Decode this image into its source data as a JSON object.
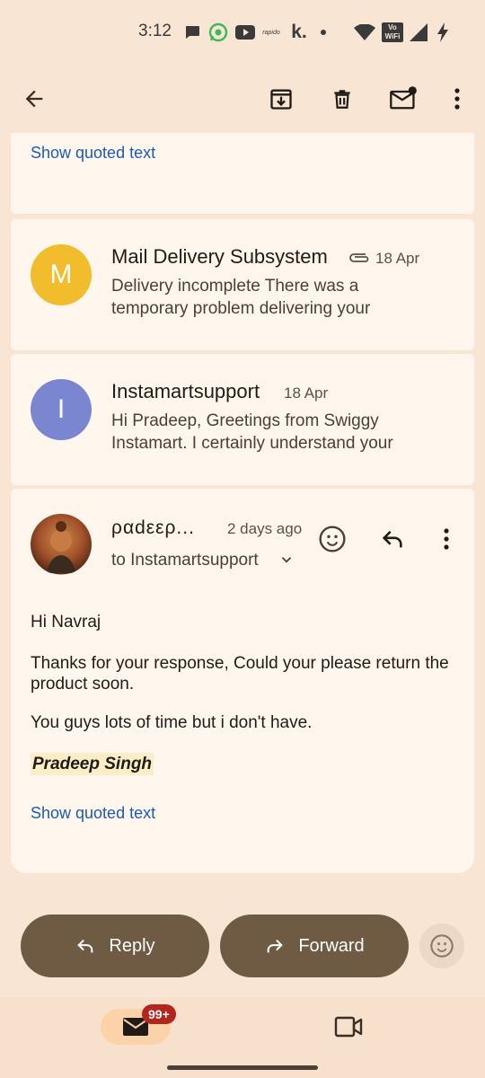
{
  "status_bar": {
    "time": "3:12",
    "rapido_label": "rapido",
    "k_label": "k.",
    "vowifi_label": "Vo WiFi"
  },
  "app_bar": {
    "icons": [
      "back-arrow-icon",
      "archive-icon",
      "delete-icon",
      "mark-unread-icon",
      "more-vert-icon"
    ]
  },
  "thread": {
    "top_card": {
      "show_quoted": "Show quoted text"
    },
    "collapsed": [
      {
        "avatar_letter": "M",
        "avatar_color": "#f2bd2c",
        "sender": "Mail Delivery Subsystem",
        "date": "18 Apr",
        "snippet": "Delivery incomplete There was a temporary problem delivering your"
      },
      {
        "avatar_letter": "I",
        "avatar_color": "#7b86d1",
        "sender": "Instamartsupport",
        "date": "18 Apr",
        "snippet": "Hi Pradeep, Greetings from Swiggy Instamart. I certainly understand your"
      }
    ],
    "expanded": {
      "sender": "ραdεερ...",
      "time": "2 days ago",
      "to": "to Instamartsupport",
      "greeting": "Hi Navraj",
      "para1": "Thanks for your response, Could your please return the product soon.",
      "para2": "You guys lots of time but i don't have.",
      "signature": "Pradeep Singh",
      "show_quoted": "Show quoted text"
    }
  },
  "actions": {
    "reply": "Reply",
    "forward": "Forward"
  },
  "bottom_nav": {
    "mail_badge": "99+"
  },
  "colors": {
    "accent": "#6f5a43",
    "link": "#1a5cb5",
    "badge": "#b3261e"
  }
}
